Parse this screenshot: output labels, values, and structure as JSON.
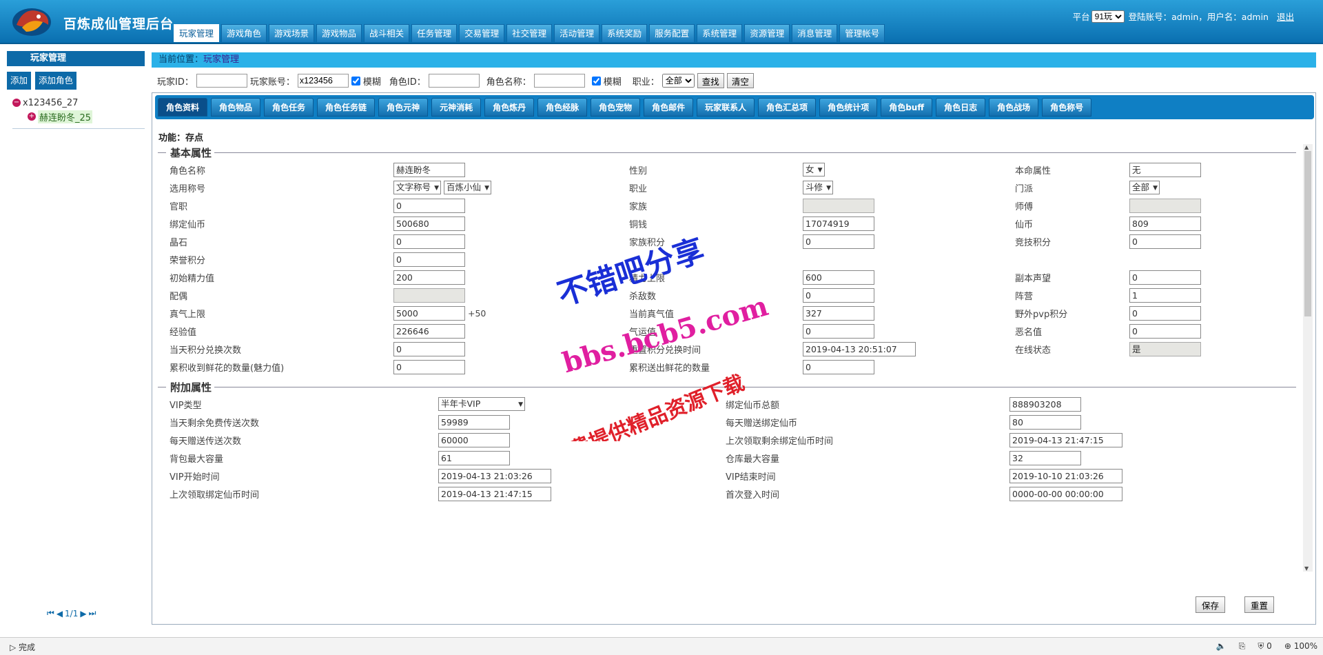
{
  "header": {
    "title": "百炼成仙管理后台",
    "nav": [
      "玩家管理",
      "游戏角色",
      "游戏场景",
      "游戏物品",
      "战斗相关",
      "任务管理",
      "交易管理",
      "社交管理",
      "活动管理",
      "系统奖励",
      "服务配置",
      "系统管理",
      "资源管理",
      "消息管理",
      "管理帐号"
    ],
    "platform_label": "平台",
    "platform_value": "91玩",
    "account_info": "登陆账号：admin，用户名：admin",
    "logout": "退出"
  },
  "sidebar": {
    "title": "玩家管理",
    "add": "添加",
    "add_role": "添加角色",
    "tree_parent": "x123456_27",
    "tree_child": "赫连盼冬_25",
    "pager": "1/1"
  },
  "crumb": {
    "label": "当前位置：",
    "current": "玩家管理"
  },
  "search": {
    "player_id_label": "玩家ID：",
    "player_id": "",
    "account_label": "玩家账号：",
    "account": "x123456",
    "fuzzy": "模糊",
    "role_id_label": "角色ID：",
    "role_id": "",
    "role_name_label": "角色名称：",
    "role_name": "",
    "job_label": "职业：",
    "job": "全部",
    "find": "查找",
    "clear": "清空"
  },
  "tabs": [
    "角色资料",
    "角色物品",
    "角色任务",
    "角色任务链",
    "角色元神",
    "元神消耗",
    "角色炼丹",
    "角色经脉",
    "角色宠物",
    "角色邮件",
    "玩家联系人",
    "角色汇总项",
    "角色统计项",
    "角色buff",
    "角色日志",
    "角色战场",
    "角色称号"
  ],
  "function": "功能：存点",
  "basic": {
    "title": "基本属性",
    "rows": [
      [
        {
          "l": "角色名称",
          "v": "赫连盼冬"
        },
        {
          "l": "性别",
          "s": "女"
        },
        {
          "l": "本命属性",
          "v": "无"
        }
      ],
      [
        {
          "l": "选用称号",
          "s": "文字称号",
          "s2": "百炼小仙"
        },
        {
          "l": "职业",
          "s": "斗修"
        },
        {
          "l": "门派",
          "s": "全部"
        }
      ],
      [
        {
          "l": "官职",
          "v": "0"
        },
        {
          "l": "家族",
          "v": "",
          "d": true
        },
        {
          "l": "师傅",
          "v": "",
          "d": true
        }
      ],
      [
        {
          "l": "绑定仙币",
          "v": "500680"
        },
        {
          "l": "铜钱",
          "v": "17074919"
        },
        {
          "l": "仙币",
          "v": "809"
        }
      ],
      [
        {
          "l": "晶石",
          "v": "0"
        },
        {
          "l": "家族积分",
          "v": "0"
        },
        {
          "l": "竞技积分",
          "v": "0"
        }
      ],
      [
        {
          "l": "荣誉积分",
          "v": "0"
        },
        {},
        {}
      ],
      [
        {
          "l": "初始精力值",
          "v": "200"
        },
        {
          "l": "精力上限",
          "v": "600"
        },
        {
          "l": "副本声望",
          "v": "0"
        }
      ],
      [
        {
          "l": "配偶",
          "v": "",
          "d": true
        },
        {
          "l": "杀敌数",
          "v": "0"
        },
        {
          "l": "阵营",
          "v": "1"
        }
      ],
      [
        {
          "l": "真气上限",
          "v": "5000",
          "x": "+50"
        },
        {
          "l": "当前真气值",
          "v": "327"
        },
        {
          "l": "野外pvp积分",
          "v": "0"
        }
      ],
      [
        {
          "l": "经验值",
          "v": "226646"
        },
        {
          "l": "气运值",
          "v": "0"
        },
        {
          "l": "恶名值",
          "v": "0"
        }
      ],
      [
        {
          "l": "当天积分兑换次数",
          "v": "0"
        },
        {
          "l": "重置积分兑换时间",
          "v": "2019-04-13 20:51:07"
        },
        {
          "l": "在线状态",
          "v": "是",
          "d": true
        }
      ],
      [
        {
          "l": "累积收到鲜花的数量(魅力值)",
          "v": "0"
        },
        {
          "l": "累积送出鲜花的数量",
          "v": "0"
        },
        {}
      ]
    ]
  },
  "extra": {
    "title": "附加属性",
    "rows": [
      [
        {
          "l": "VIP类型",
          "s": "半年卡VIP"
        },
        {
          "l": "绑定仙币总额",
          "v": "888903208"
        }
      ],
      [
        {
          "l": "当天剩余免费传送次数",
          "v": "59989"
        },
        {
          "l": "每天赠送绑定仙币",
          "v": "80"
        }
      ],
      [
        {
          "l": "每天赠送传送次数",
          "v": "60000"
        },
        {
          "l": "上次领取剩余绑定仙币时间",
          "v": "2019-04-13 21:47:15"
        }
      ],
      [
        {
          "l": "背包最大容量",
          "v": "61"
        },
        {
          "l": "仓库最大容量",
          "v": "32"
        }
      ],
      [
        {
          "l": "VIP开始时间",
          "v": "2019-04-13 21:03:26"
        },
        {
          "l": "VIP结束时间",
          "v": "2019-10-10 21:03:26"
        }
      ],
      [
        {
          "l": "上次领取绑定仙币时间",
          "v": "2019-04-13 21:47:15"
        },
        {
          "l": "首次登入时间",
          "v": "0000-00-00 00:00:00"
        }
      ]
    ]
  },
  "actions": {
    "save": "保存",
    "reset": "重置"
  },
  "status": {
    "left": "完成",
    "zoom": "100%",
    "count": "0"
  },
  "watermark": [
    "不错吧分享",
    "bbs.bcb5.com",
    "免费提供精品资源下载"
  ]
}
